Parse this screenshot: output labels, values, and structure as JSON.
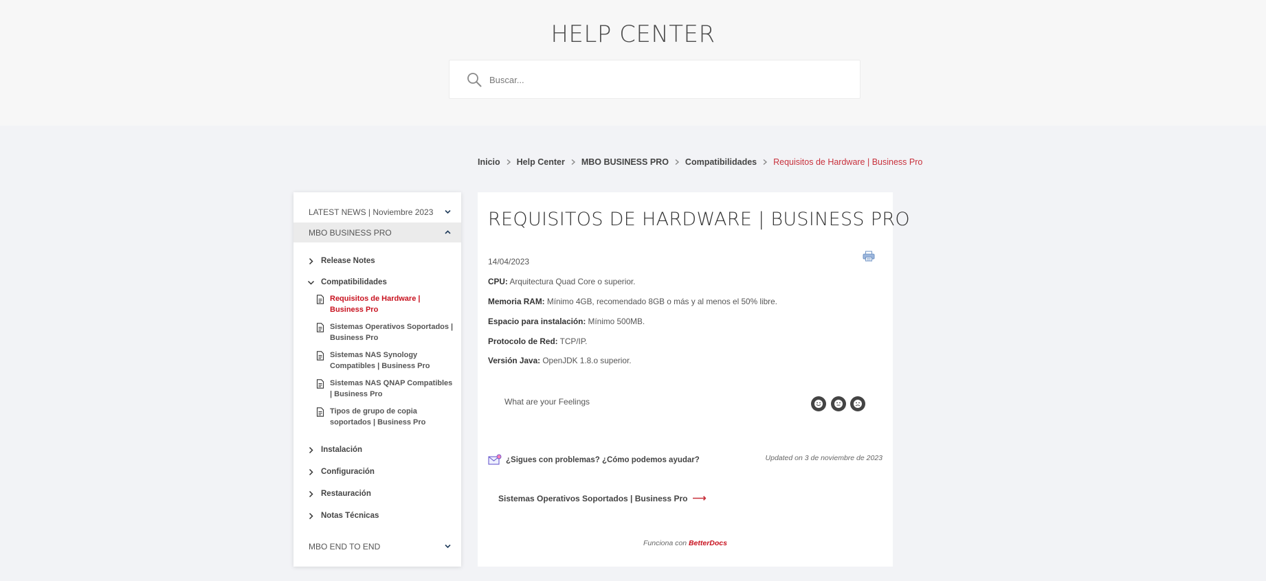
{
  "hero": {
    "title": "HELP CENTER",
    "search_placeholder": "Buscar..."
  },
  "breadcrumb": {
    "items": [
      "Inicio",
      "Help Center",
      "MBO BUSINESS PRO",
      "Compatibilidades"
    ],
    "current": "Requisitos de Hardware | Business Pro"
  },
  "sidebar": {
    "categories": [
      {
        "label": "LATEST NEWS | Noviembre 2023",
        "expanded": false
      },
      {
        "label": "MBO BUSINESS PRO",
        "expanded": true
      },
      {
        "label": "MBO END TO END",
        "expanded": false
      }
    ],
    "subcategories": [
      {
        "label": "Release Notes",
        "expanded": false
      },
      {
        "label": "Compatibilidades",
        "expanded": true
      },
      {
        "label": "Instalación",
        "expanded": false
      },
      {
        "label": "Configuración",
        "expanded": false
      },
      {
        "label": "Restauración",
        "expanded": false
      },
      {
        "label": "Notas Técnicas",
        "expanded": false
      }
    ],
    "docs": [
      {
        "label": "Requisitos de Hardware | Business Pro",
        "current": true
      },
      {
        "label": "Sistemas Operativos Soportados | Business Pro",
        "current": false
      },
      {
        "label": "Sistemas NAS Synology Compatibles | Business Pro",
        "current": false
      },
      {
        "label": "Sistemas NAS QNAP Compatibles | Business Pro",
        "current": false
      },
      {
        "label": "Tipos de grupo de copia soportados | Business Pro",
        "current": false
      }
    ]
  },
  "article": {
    "title": "REQUISITOS DE HARDWARE | BUSINESS PRO",
    "date": "14/04/2023",
    "specs": [
      {
        "label": "CPU:",
        "value": "Arquitectura Quad Core o superior."
      },
      {
        "label": "Memoria RAM:",
        "value": "Mínimo 4GB, recomendado 8GB o más y al menos el 50% libre."
      },
      {
        "label": "Espacio para instalación:",
        "value": "Mínimo 500MB."
      },
      {
        "label": "Protocolo de Red:",
        "value": "TCP/IP."
      },
      {
        "label": "Versión Java:",
        "value": "OpenJDK 1.8.o superior."
      }
    ],
    "feelings_prompt": "What are your Feelings",
    "help_text": "¿Sigues con problemas? ¿Cómo podemos ayudar?",
    "updated": "Updated on 3 de noviembre de 2023",
    "next_link": "Sistemas Operativos Soportados | Business Pro",
    "powered_prefix": "Funciona con",
    "powered_brand": "BetterDocs"
  },
  "colors": {
    "accent": "#c8313c",
    "current_doc": "#c8121f"
  },
  "icons": {
    "search": "search-icon",
    "chevron": "chevron-icon",
    "document": "document-icon",
    "print": "print-icon",
    "help": "help-envelope-icon",
    "arrow": "arrow-right-icon"
  }
}
